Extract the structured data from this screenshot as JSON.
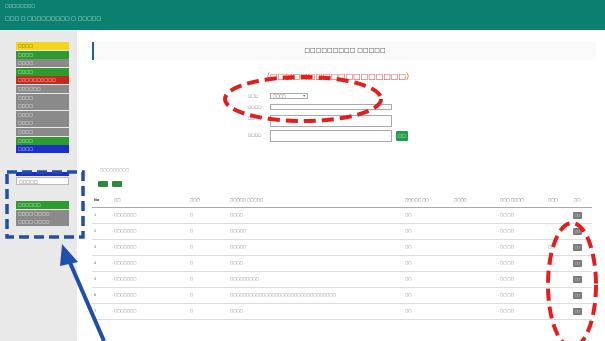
{
  "header": {
    "brand": "□□□□□□□□",
    "breadcrumb": "□□□ □ □□□□□□□□□ □ □□□□□"
  },
  "sidebar": {
    "items": [
      {
        "label": "□□□□",
        "color": "#f2d51f"
      },
      {
        "label": "□□□□",
        "color": "#2e9b2e"
      },
      {
        "label": "□□□□",
        "color": "#8a8a8a"
      },
      {
        "label": "□□□□",
        "color": "#2e9b2e"
      },
      {
        "label": "□□□□□□□□□□",
        "color": "#c42b1d"
      },
      {
        "label": "□□□□□□",
        "color": "#8a8a8a"
      },
      {
        "label": "□□□□",
        "color": "#8a8a8a"
      },
      {
        "label": "□□□□",
        "color": "#8a8a8a"
      },
      {
        "label": "□□□□",
        "color": "#8a8a8a"
      },
      {
        "label": "□□□□",
        "color": "#8a8a8a"
      },
      {
        "label": "□□□□",
        "color": "#8a8a8a"
      },
      {
        "label": "□□□□",
        "color": "#2e9b2e"
      },
      {
        "label": "□□□□",
        "color": "#1c2fc8"
      }
    ],
    "user_label": "□□□□□",
    "secondary": [
      {
        "label": "□□□□□□",
        "color": "#2e9b2e"
      },
      {
        "label": "□□□□ □□□□",
        "color": "#8a8a8a"
      },
      {
        "label": "□□□□ □□□□",
        "color": "#8a8a8a"
      }
    ]
  },
  "main": {
    "page_title": "□□□□□□□□□ □□□□□",
    "highlight": "（□□□□□□□□□□□□□□□□□□）",
    "form": {
      "field1_label": "□□□",
      "field1_value": "□□□□",
      "field2_label": "□□□□",
      "field3_label": "□□",
      "field4_label": "□□□□",
      "search_label": "□□"
    },
    "list_caption": "□□□□□□□□□"
  },
  "table": {
    "headers": [
      "No",
      "□□",
      "□□□",
      "□□□□□ □□□□□",
      "□□□□□ □□",
      "□□□□",
      "□□□ □□□□",
      "□□□",
      "□□"
    ],
    "rows": [
      [
        "1",
        "□□□□□□□",
        "□",
        "□□□□",
        "□□",
        "",
        "□□ □□",
        "",
        "□□"
      ],
      [
        "2",
        "□□□□□□□",
        "□",
        "□□□□□",
        "□□",
        "",
        "□□ □□",
        "",
        "□□"
      ],
      [
        "3",
        "□□□□□□□",
        "□",
        "□□□□□",
        "□□",
        "",
        "□□ □□",
        "□□",
        "□□"
      ],
      [
        "4",
        "□□□□□□□",
        "□",
        "□□□□",
        "□□",
        "",
        "□□ □□",
        "□□",
        "□□"
      ],
      [
        "5",
        "□□□□□□□",
        "□",
        "□□□□□□□□□",
        "□□",
        "",
        "□□ □□",
        "",
        "□□"
      ],
      [
        "6",
        "□□□□□□□",
        "□",
        "□□□□□□□□□□□□□□□□□□□□□□□□□□□□□□□□□",
        "□□",
        "",
        "□□ □□",
        "",
        "□□"
      ],
      [
        "7",
        "□□□□□□□",
        "□",
        "□□□□",
        "□□",
        "",
        "□□ □□",
        "",
        "□□"
      ]
    ]
  },
  "colors": {
    "header_bg": "#0b7f70",
    "annotation_red": "#e41d1d",
    "annotation_blue": "#1f4fa8"
  }
}
